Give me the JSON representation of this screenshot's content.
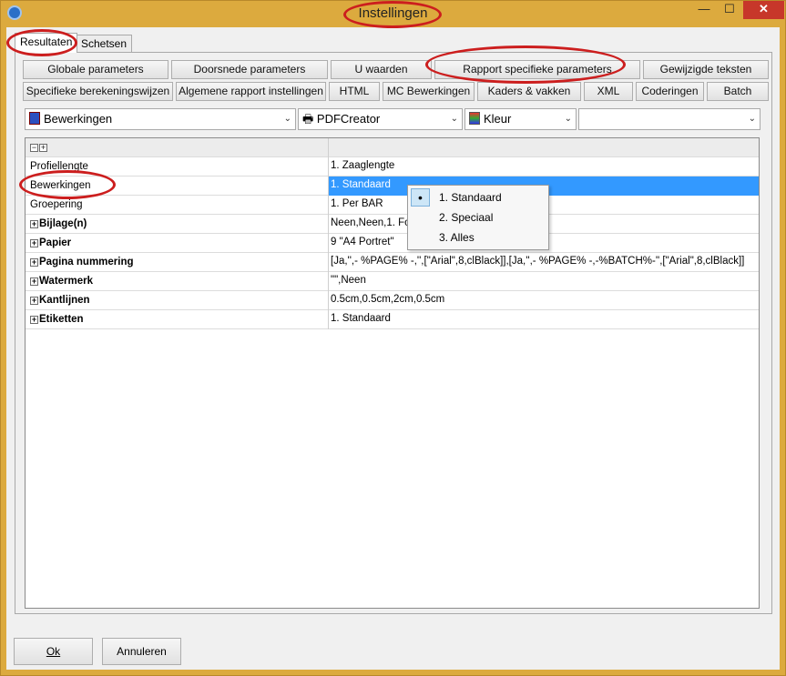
{
  "window": {
    "title": "Instellingen",
    "controls": {
      "minimize": "—",
      "maximize": "☐",
      "close": "✕"
    }
  },
  "tabs": [
    {
      "label": "Resultaten",
      "active": true
    },
    {
      "label": "Schetsen",
      "active": false
    }
  ],
  "button_row1": [
    "Globale parameters",
    "Doorsnede parameters",
    "U waarden",
    "Rapport specifieke parameters",
    "Gewijzigde teksten"
  ],
  "button_row2": [
    "Specifieke berekeningswijzen",
    "Algemene rapport instellingen",
    "HTML",
    "MC Bewerkingen",
    "Kaders & vakken",
    "XML",
    "Coderingen",
    "Batch"
  ],
  "combos": {
    "report": "Bewerkingen",
    "printer": "PDFCreator",
    "color": "Kleur",
    "extra": ""
  },
  "grid": {
    "header_toggles": [
      "−",
      "+"
    ],
    "rows": [
      {
        "label": "Profiellengte",
        "value": "1. Zaaglengte",
        "expandable": false,
        "bold": false,
        "selected": false
      },
      {
        "label": "Bewerkingen",
        "value": "1. Standaard",
        "expandable": false,
        "bold": false,
        "selected": true
      },
      {
        "label": "Groepering",
        "value": "1. Per BAR",
        "expandable": false,
        "bold": false,
        "selected": false
      },
      {
        "label": "Bijlage(n)",
        "value": "Neen,Neen,1. Fol",
        "expandable": true,
        "bold": true,
        "selected": false
      },
      {
        "label": "Papier",
        "value": "9 \"A4 Portret\"",
        "expandable": true,
        "bold": true,
        "selected": false
      },
      {
        "label": "Pagina nummering",
        "value": "[Ja,'',- %PAGE% -,'',[\"Arial\",8,clBlack]],[Ja,'',- %PAGE% -,-%BATCH%-'',[\"Arial\",8,clBlack]]",
        "expandable": true,
        "bold": true,
        "selected": false
      },
      {
        "label": "Watermerk",
        "value": "\"\",Neen",
        "expandable": true,
        "bold": true,
        "selected": false
      },
      {
        "label": "Kantlijnen",
        "value": "0.5cm,0.5cm,2cm,0.5cm",
        "expandable": true,
        "bold": true,
        "selected": false
      },
      {
        "label": "Etiketten",
        "value": "1. Standaard",
        "expandable": true,
        "bold": true,
        "selected": false
      }
    ]
  },
  "dropdown_options": [
    {
      "label": "1. Standaard",
      "selected": true
    },
    {
      "label": "2. Speciaal",
      "selected": false
    },
    {
      "label": "3. Alles",
      "selected": false
    }
  ],
  "footer": {
    "ok": "Ok",
    "cancel": "Annuleren"
  },
  "colors": {
    "titlebar": "#dcaa3e",
    "selection": "#3399ff",
    "annotation": "#cc1e1e",
    "close_button": "#c7372a"
  }
}
